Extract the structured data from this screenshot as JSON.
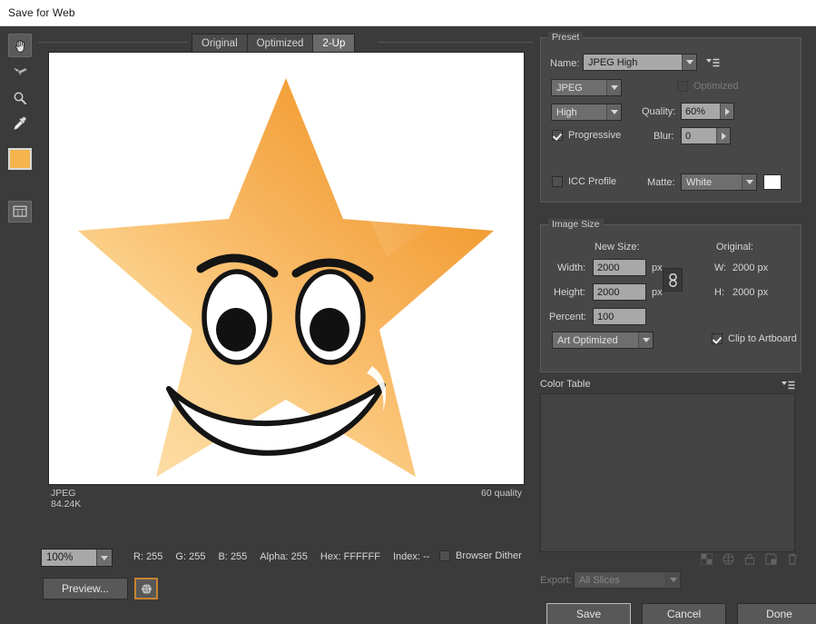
{
  "window": {
    "title": "Save for Web"
  },
  "tools": [
    {
      "name": "hand-tool",
      "selected": true
    },
    {
      "name": "slice-select-tool",
      "selected": false
    },
    {
      "name": "zoom-tool",
      "selected": false
    },
    {
      "name": "eyedropper-tool",
      "selected": false
    }
  ],
  "swatch": {
    "color": "#F5B44E"
  },
  "slice_visibility": {
    "name": "toggle-slices-visibility"
  },
  "preview": {
    "tabs": [
      {
        "label": "Original",
        "active": false
      },
      {
        "label": "Optimized",
        "active": false
      },
      {
        "label": "2-Up",
        "active": true
      }
    ],
    "info": {
      "format": "JPEG",
      "filesize": "84.24K",
      "quality": "60 quality"
    },
    "image": {
      "name": "smiling-star-artwork",
      "star_color_light": "#FBD391",
      "star_color_dark": "#F2982F"
    }
  },
  "status": {
    "zoom": "100%",
    "readouts": [
      {
        "label": "R:",
        "value": "255"
      },
      {
        "label": "G:",
        "value": "255"
      },
      {
        "label": "B:",
        "value": "255"
      },
      {
        "label": "Alpha:",
        "value": "255"
      },
      {
        "label": "Hex:",
        "value": "FFFFFF"
      },
      {
        "label": "Index:",
        "value": "--"
      }
    ],
    "browser_dither": {
      "label": "Browser Dither",
      "checked": false
    }
  },
  "buttons": {
    "preview": "Preview...",
    "browser_icon": "globe-icon",
    "save": "Save",
    "cancel": "Cancel",
    "done": "Done"
  },
  "preset": {
    "legend": "Preset",
    "name_label": "Name:",
    "name_value": "JPEG High",
    "format_value": "JPEG",
    "optimized": {
      "label": "Optimized",
      "checked": false,
      "enabled": false
    },
    "compression_value": "High",
    "quality_label": "Quality:",
    "quality_value": "60%",
    "progressive": {
      "label": "Progressive",
      "checked": true
    },
    "blur_label": "Blur:",
    "blur_value": "0",
    "icc_profile": {
      "label": "ICC Profile",
      "checked": false
    },
    "matte_label": "Matte:",
    "matte_value": "White",
    "matte_color": "#FFFFFF",
    "menu_icon": "preset-menu-icon"
  },
  "image_size": {
    "legend": "Image Size",
    "new_size_label": "New Size:",
    "original_label": "Original:",
    "width_label": "Width:",
    "width_value": "2000",
    "width_unit": "px",
    "height_label": "Height:",
    "height_value": "2000",
    "height_unit": "px",
    "percent_label": "Percent:",
    "percent_value": "100",
    "orig_w_label": "W:",
    "orig_w_value": "2000 px",
    "orig_h_label": "H:",
    "orig_h_value": "2000 px",
    "quality_mode": "Art Optimized",
    "clip_to_artboard": {
      "label": "Clip to Artboard",
      "checked": true
    },
    "link_icon": "chain-link-icon"
  },
  "color_table": {
    "legend": "Color Table",
    "menu_icon": "color-table-menu-icon",
    "icons": [
      "transparency-icon",
      "web-shift-icon",
      "lock-icon",
      "new-color-icon",
      "delete-color-icon"
    ]
  },
  "export": {
    "label": "Export:",
    "value": "All Slices",
    "enabled": false
  }
}
